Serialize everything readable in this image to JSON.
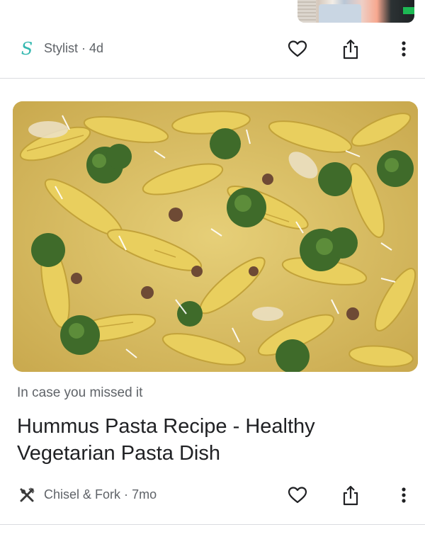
{
  "previous_card": {
    "source": "Stylist",
    "age": "4d",
    "separator": "·",
    "source_icon": "stylist-s-icon"
  },
  "current_card": {
    "kicker": "In case you missed it",
    "headline": "Hummus Pasta Recipe - Healthy Vegetarian Pasta Dish",
    "source": "Chisel & Fork",
    "age": "7mo",
    "separator": "·",
    "source_icon": "crossed-utensils-icon",
    "image_icon": "pasta-broccoli-photo"
  },
  "actions": {
    "like_icon": "heart-icon",
    "share_icon": "share-icon",
    "more_icon": "more-vert-icon"
  },
  "colors": {
    "stylist_brand": "#35b8b0",
    "secondary_text": "#5f6368",
    "primary_text": "#202124",
    "divider": "#dadce0"
  }
}
